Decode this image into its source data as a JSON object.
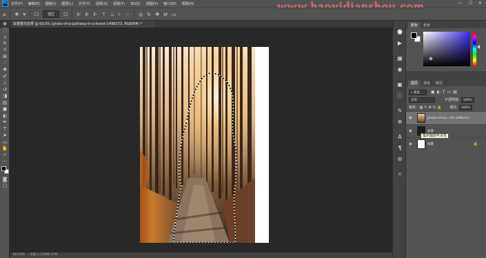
{
  "app": {
    "logo": "Ps"
  },
  "menu": [
    "文件(F)",
    "编辑(E)",
    "图像(I)",
    "图层(L)",
    "文字(Y)",
    "选择(S)",
    "滤镜(T)",
    "3D(D)",
    "视图(V)",
    "窗口(W)",
    "帮助(H)"
  ],
  "watermark": "www.haoyidianshou.com",
  "window_controls": {
    "minimize": "—",
    "maximize": "☐",
    "close": "✕"
  },
  "options": {
    "style_label": "选区"
  },
  "document_tab": {
    "title": "双重曝光效果 @ 60.6% (photo-of-a-pathway-in-a-forest-1496373, RGB/8#) *",
    "close": "×"
  },
  "status": {
    "zoom": "60.63%",
    "doc": "文档:3.11M/6.37M"
  },
  "panels": {
    "color_tabs": [
      "颜色",
      "色板"
    ],
    "layer_tabs": [
      "图层",
      "通道",
      "路径"
    ],
    "filter_label": "类型",
    "blend_mode": "正常",
    "opacity_label": "不透明度:",
    "opacity_value": "100%",
    "lock_label": "锁定:",
    "fill_label": "填充:",
    "fill_value": "100%",
    "layers": [
      {
        "name": "photo-of-a-p...est-1496373",
        "selected": true
      },
      {
        "name": "女孩",
        "selected": false
      },
      {
        "name": "背景",
        "selected": false,
        "locked": true
      }
    ],
    "tooltip": "指示图层可见性"
  },
  "colors": {
    "accent": "#31a8ff",
    "selection_tab": "#424242",
    "panel_bg": "#535353",
    "workspace": "#282828"
  }
}
